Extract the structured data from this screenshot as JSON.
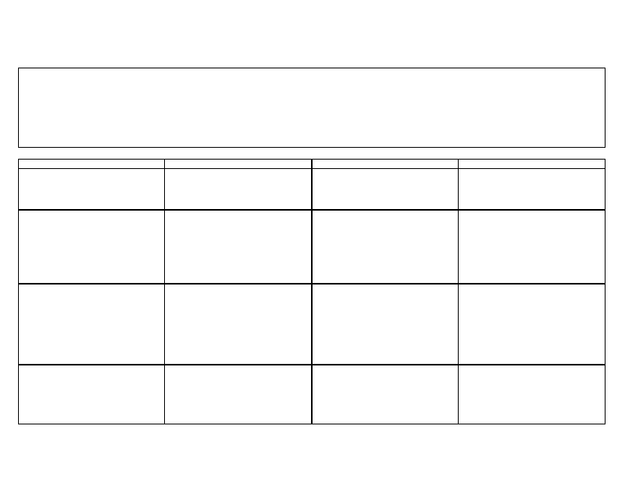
{
  "document": {
    "header_text": "",
    "table": {
      "columns": [
        "",
        "",
        "",
        ""
      ],
      "rows": [
        [
          "",
          "",
          "",
          ""
        ],
        [
          "",
          "",
          "",
          ""
        ],
        [
          "",
          "",
          "",
          ""
        ],
        [
          "",
          "",
          "",
          ""
        ]
      ]
    }
  }
}
